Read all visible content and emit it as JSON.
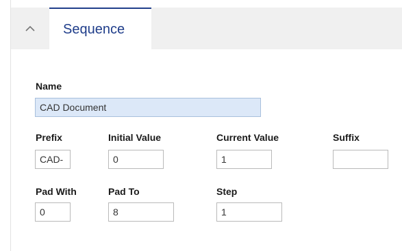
{
  "panel": {
    "collapse_icon": "chevron-up-icon",
    "tab_label": "Sequence"
  },
  "form": {
    "name": {
      "label": "Name",
      "value": "CAD Document"
    },
    "prefix": {
      "label": "Prefix",
      "value": "CAD-"
    },
    "initial_value": {
      "label": "Initial Value",
      "value": "0"
    },
    "current_value": {
      "label": "Current Value",
      "value": "1"
    },
    "suffix": {
      "label": "Suffix",
      "value": ""
    },
    "pad_with": {
      "label": "Pad With",
      "value": "0"
    },
    "pad_to": {
      "label": "Pad To",
      "value": "8"
    },
    "step": {
      "label": "Step",
      "value": "1"
    }
  },
  "colors": {
    "accent": "#1f3d8a",
    "readonly_field_bg": "#dce8f8",
    "tabbar_bg": "#f0f0f0"
  }
}
